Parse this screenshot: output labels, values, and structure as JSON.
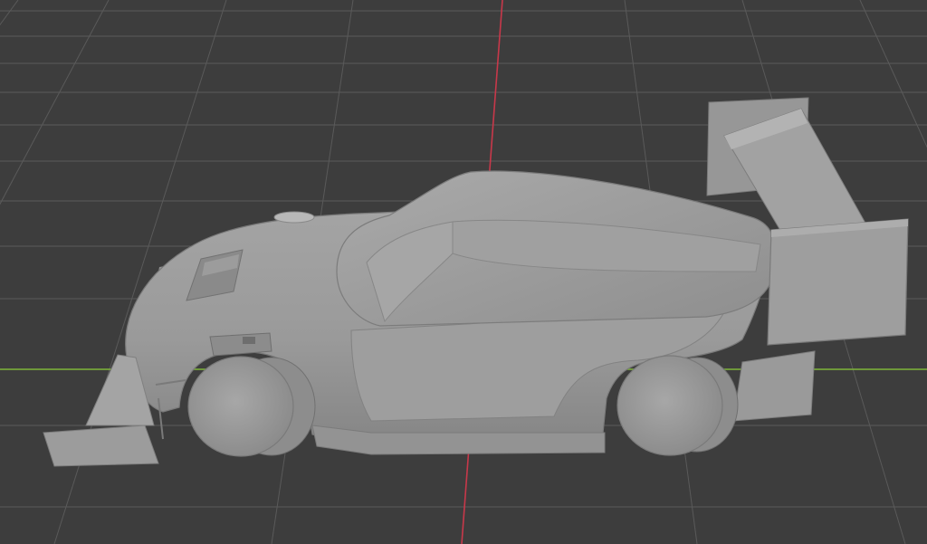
{
  "viewport": {
    "mode": "solid-shading",
    "background_color": "#3d3d3d",
    "grid_color": "#5a5a5a",
    "x_axis_color": "#7fb63a",
    "y_axis_color": "#c8384a",
    "model_color": "#9b9b9b"
  }
}
